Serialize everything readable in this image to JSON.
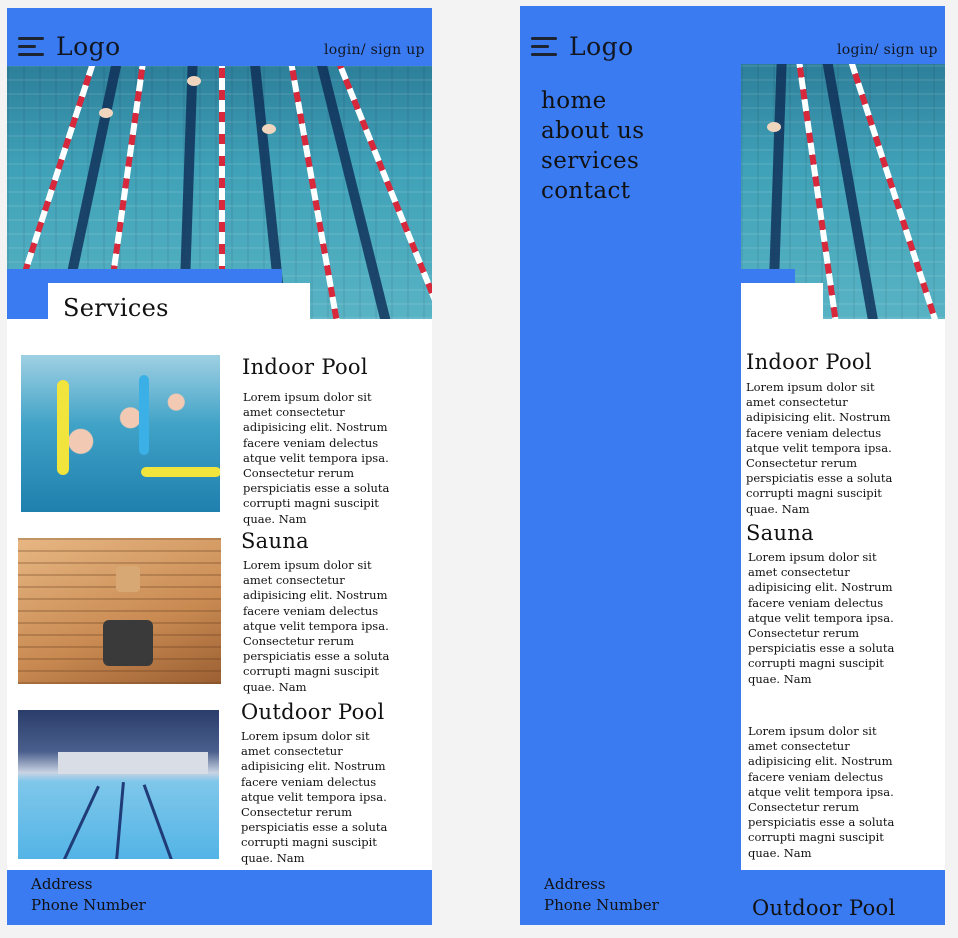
{
  "header": {
    "logo": "Logo",
    "login": "login/ sign up"
  },
  "menu": {
    "items": [
      "home",
      "about us",
      "services",
      "contact"
    ]
  },
  "services": {
    "heading": "Services",
    "items": [
      {
        "title": "Indoor Pool",
        "text": "Lorem ipsum dolor sit amet consectetur adipisicing elit. Nostrum facere veniam delectus atque velit tempora ipsa. Consectetur rerum perspiciatis esse a soluta corrupti magni suscipit quae. Nam"
      },
      {
        "title": "Sauna",
        "text": "Lorem ipsum dolor sit amet consectetur adipisicing elit. Nostrum facere veniam delectus atque velit tempora ipsa. Consectetur rerum perspiciatis esse a soluta corrupti magni suscipit quae. Nam"
      },
      {
        "title": "Outdoor Pool",
        "text": "Lorem ipsum dolor sit amet consectetur adipisicing elit. Nostrum facere veniam delectus atque velit tempora ipsa. Consectetur rerum perspiciatis esse a soluta corrupti magni suscipit quae. Nam"
      }
    ]
  },
  "footer": {
    "address": "Address",
    "phone": "Phone Number"
  },
  "colors": {
    "brand_blue": "#3a7bf2",
    "text": "#111111",
    "page_bg": "#f3f3f4"
  },
  "icons": {
    "menu": "hamburger-menu-icon"
  }
}
